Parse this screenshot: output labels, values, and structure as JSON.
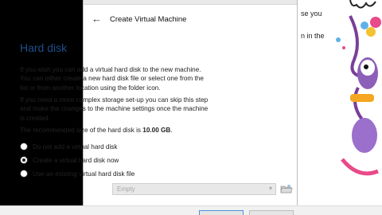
{
  "dialog": {
    "title": "Create Virtual Machine",
    "heading": "Hard disk",
    "paragraph1": "If you wish you can add a virtual hard disk to the new machine. You can either create a new hard disk file or select one from the list or from another location using the folder icon.",
    "paragraph2": "If you need a more complex storage set-up you can skip this step and make the changes to the machine settings once the machine is created.",
    "recommended_prefix": "The recommended size of the hard disk is ",
    "recommended_size": "10.00 GB",
    "recommended_suffix": ".",
    "options": [
      {
        "label": "Do not add a virtual hard disk",
        "selected": false
      },
      {
        "label": "Create a virtual hard disk now",
        "selected": true
      },
      {
        "label": "Use an existing virtual hard disk file",
        "selected": false
      }
    ],
    "file_select_value": "Empty"
  },
  "background_app": {
    "line1": "se you",
    "line2": "n in the"
  },
  "icons": {
    "back": "back-arrow-icon",
    "dropdown": "chevron-down-icon",
    "folder": "folder-icon",
    "mascot": "mascot-illustration"
  },
  "colors": {
    "heading": "#1f4f8a",
    "accent": "#4a90d9"
  }
}
